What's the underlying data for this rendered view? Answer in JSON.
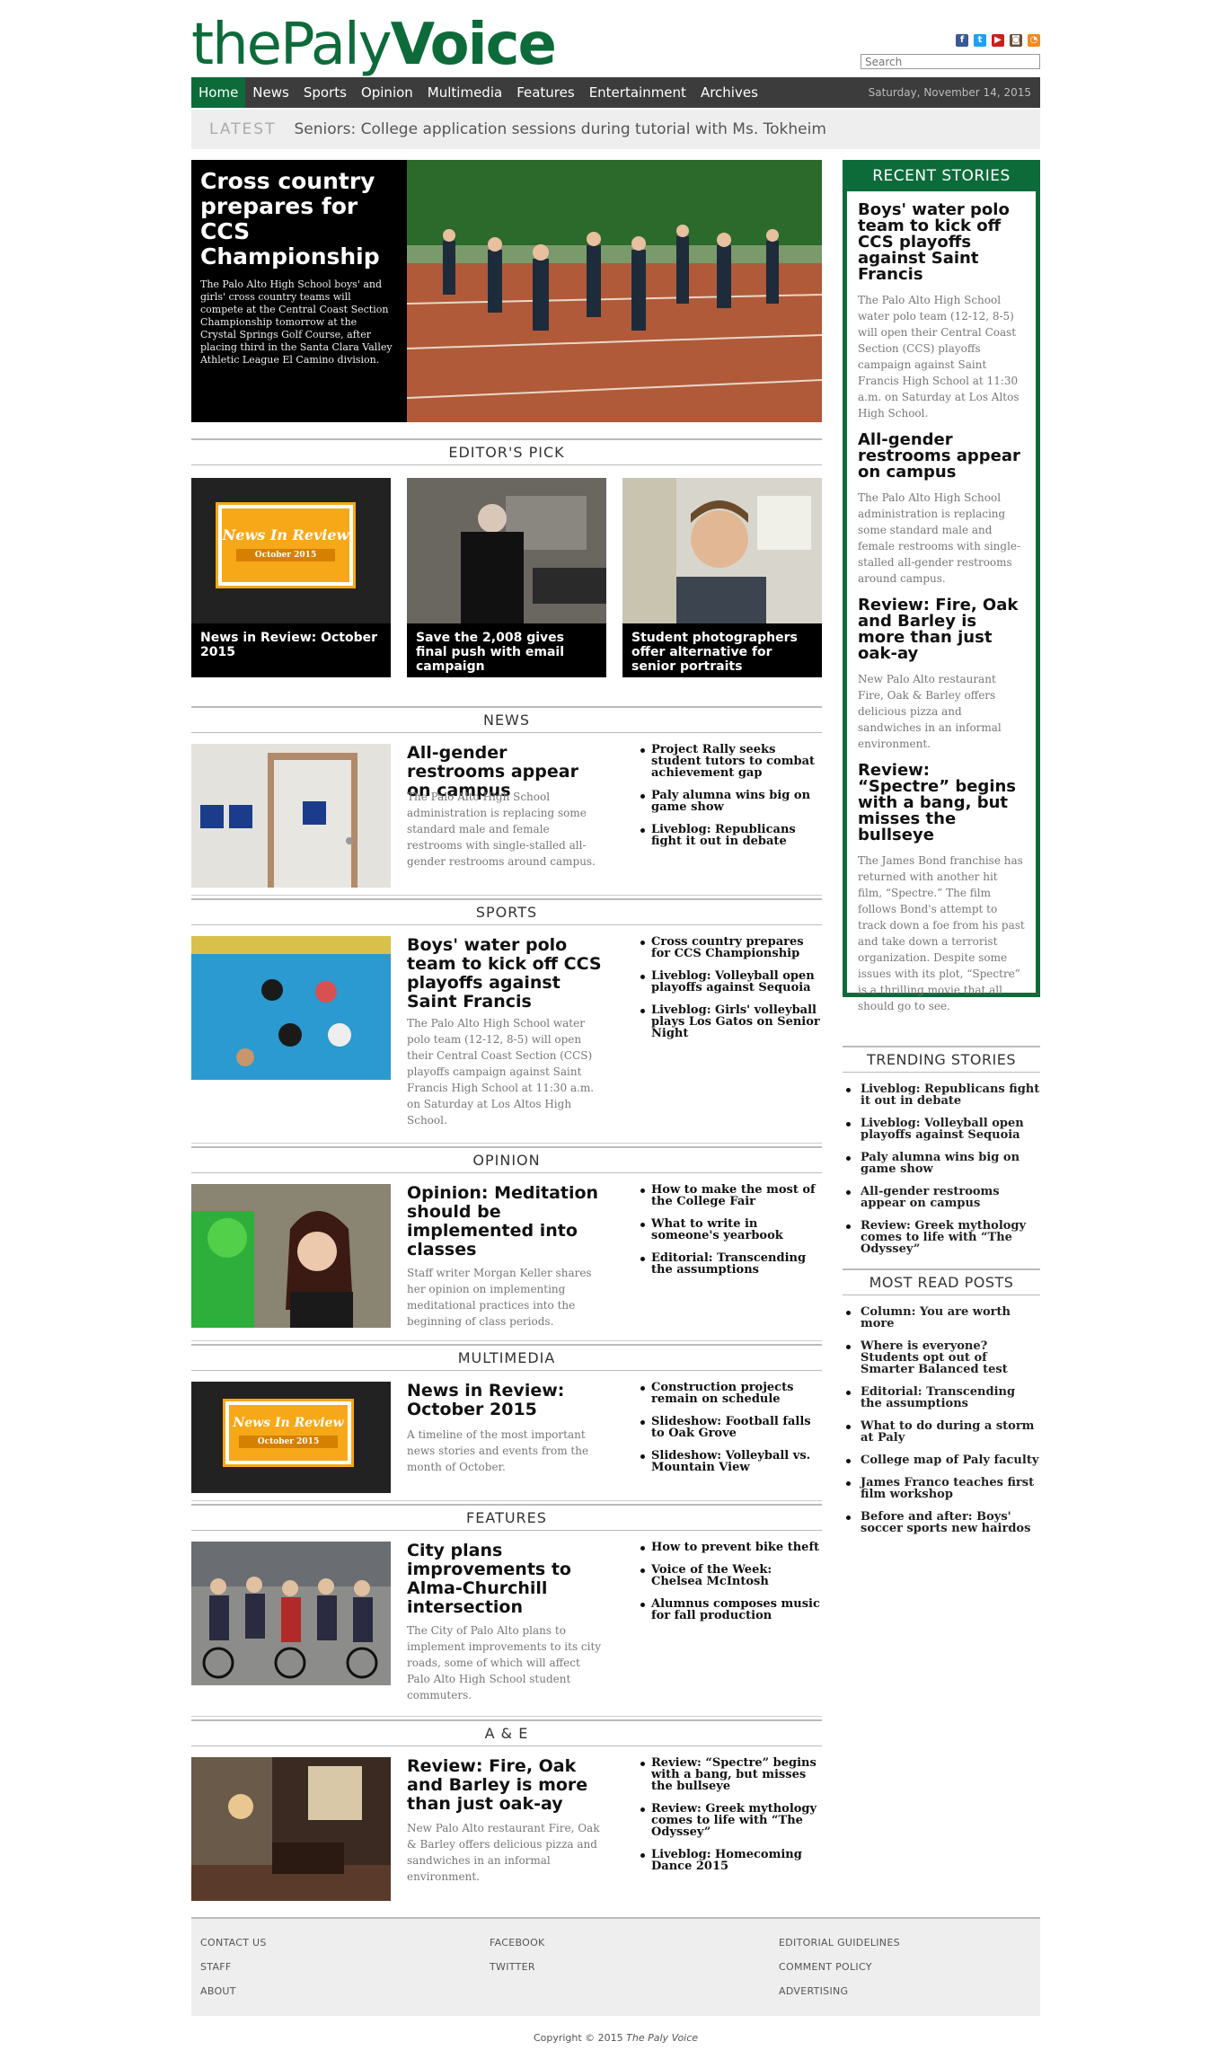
{
  "masthead": {
    "logo_the": "the",
    "logo_paly": "Paly",
    "logo_voice": "Voice",
    "search_placeholder": "Search"
  },
  "social": [
    {
      "icon": "facebook-icon",
      "glyph": "f",
      "color": "#3b5998"
    },
    {
      "icon": "twitter-icon",
      "glyph": "t",
      "color": "#1da1f2"
    },
    {
      "icon": "youtube-icon",
      "glyph": "▶",
      "color": "#cc1f1f"
    },
    {
      "icon": "instagram-icon",
      "glyph": "◙",
      "color": "#6b4f3a"
    },
    {
      "icon": "rss-icon",
      "glyph": "◔",
      "color": "#f08a24"
    }
  ],
  "nav": {
    "items": [
      "Home",
      "News",
      "Sports",
      "Opinion",
      "Multimedia",
      "Features",
      "Entertainment",
      "Archives"
    ],
    "date": "Saturday, November 14, 2015"
  },
  "latest": {
    "label": "LATEST",
    "text": "Seniors: College application sessions during tutorial with Ms. Tokheim"
  },
  "hero": {
    "title": "Cross country prepares for CCS Championship",
    "summary": "The Palo Alto High School boys' and girls' cross country teams will compete at the Central Coast Section Championship tomorrow at the Crystal Springs Golf Course, after placing third in the Santa Clara Valley Athletic League El Camino division."
  },
  "editors_pick": {
    "heading": "EDITOR'S PICK",
    "items": [
      {
        "caption": "News in Review: October 2015",
        "graphic_title": "News In Review",
        "graphic_sub": "October 2015"
      },
      {
        "caption": "Save the 2,008 gives final push with email campaign"
      },
      {
        "caption": "Student photographers offer alternative for senior portraits"
      }
    ]
  },
  "sections": [
    {
      "heading": "NEWS",
      "title": "All-gender restrooms appear on campus",
      "summary": "The Palo Alto High School administration is replacing some standard male and female restrooms with single-stalled all-gender restrooms around campus.",
      "links": [
        "Project Rally seeks student tutors to combat achievement gap",
        "Paly alumna wins big on game show",
        "Liveblog: Republicans fight it out in debate"
      ]
    },
    {
      "heading": "SPORTS",
      "title": "Boys' water polo team to kick off CCS playoffs against Saint Francis",
      "summary": "The Palo Alto High School water polo team (12-12, 8-5) will open their Central Coast Section (CCS) playoffs campaign against Saint Francis High School at 11:30 a.m. on Saturday at Los Altos High School.",
      "links": [
        "Cross country prepares for CCS Championship",
        "Liveblog: Volleyball open playoffs against Sequoia",
        "Liveblog: Girls' volleyball plays Los Gatos on Senior Night"
      ]
    },
    {
      "heading": "OPINION",
      "title": "Opinion: Meditation should be implemented into classes",
      "summary": "Staff writer Morgan Keller shares her opinion on implementing meditational practices into the beginning of class periods.",
      "links": [
        "How to make the most of the College Fair",
        "What to write in someone's yearbook",
        "Editorial: Transcending the assumptions"
      ]
    },
    {
      "heading": "MULTIMEDIA",
      "title": "News in Review: October 2015",
      "summary": "A timeline of the most important news stories and events from the month of October.",
      "links": [
        "Construction projects remain on schedule",
        "Slideshow: Football falls to Oak Grove",
        "Slideshow: Volleyball vs. Mountain View"
      ]
    },
    {
      "heading": "FEATURES",
      "title": "City plans improvements to Alma-Churchill intersection",
      "summary": "The City of Palo Alto plans to implement improvements to its city roads, some of which will affect Palo Alto High School student commuters.",
      "links": [
        "How to prevent bike theft",
        "Voice of the Week: Chelsea McIntosh",
        "Alumnus composes music for fall production"
      ]
    },
    {
      "heading": "A & E",
      "title": "Review: Fire, Oak and Barley is more than just oak-ay",
      "summary": "New Palo Alto restaurant Fire, Oak & Barley offers delicious pizza and sandwiches in an informal environment.",
      "links": [
        "Review: “Spectre” begins with a bang, but misses the bullseye",
        "Review: Greek mythology comes to life with “The Odyssey”",
        "Liveblog: Homecoming Dance 2015"
      ]
    }
  ],
  "recent": {
    "heading": "RECENT STORIES",
    "items": [
      {
        "title": "Boys' water polo team to kick off CCS playoffs against Saint Francis",
        "summary": "The Palo Alto High School water polo team (12-12, 8-5) will open their Central Coast Section (CCS) playoffs campaign against Saint Francis High School at 11:30 a.m. on Saturday at Los Altos High School."
      },
      {
        "title": "All-gender restrooms appear on campus",
        "summary": "The Palo Alto High School administration is replacing some standard male and female restrooms with single-stalled all-gender restrooms around campus."
      },
      {
        "title": "Review: Fire, Oak and Barley is more than just oak-ay",
        "summary": "New Palo Alto restaurant Fire, Oak & Barley offers delicious pizza and sandwiches in an informal environment."
      },
      {
        "title": "Review: “Spectre” begins with a bang, but misses the bullseye",
        "summary": "The James Bond franchise has returned with another hit film, “Spectre.” The film follows Bond's attempt to track down a foe from his past and take down a terrorist organization. Despite some issues with its plot, “Spectre” is a thrilling movie that all should go to see."
      }
    ]
  },
  "trending": {
    "heading": "TRENDING STORIES",
    "items": [
      "Liveblog: Republicans fight it out in debate",
      "Liveblog: Volleyball open playoffs against Sequoia",
      "Paly alumna wins big on game show",
      "All-gender restrooms appear on campus",
      "Review: Greek mythology comes to life with “The Odyssey”"
    ]
  },
  "most_read": {
    "heading": "MOST READ POSTS",
    "items": [
      "Column: You are worth more",
      "Where is everyone? Students opt out of Smarter Balanced test",
      "Editorial: Transcending the assumptions",
      "What to do during a storm at Paly",
      "College map of Paly faculty",
      "James Franco teaches first film workshop",
      "Before and after: Boys' soccer sports new hairdos"
    ]
  },
  "footer": {
    "col1": [
      "CONTACT US",
      "STAFF",
      "ABOUT"
    ],
    "col2": [
      "FACEBOOK",
      "TWITTER"
    ],
    "col3": [
      "EDITORIAL GUIDELINES",
      "COMMENT POLICY",
      "ADVERTISING"
    ],
    "copyright_prefix": "Copyright © 2015 ",
    "copyright_name": "The Paly Voice"
  },
  "colors": {
    "brand_green": "#0d6b3a",
    "nav_bg": "#3c3c3c"
  }
}
